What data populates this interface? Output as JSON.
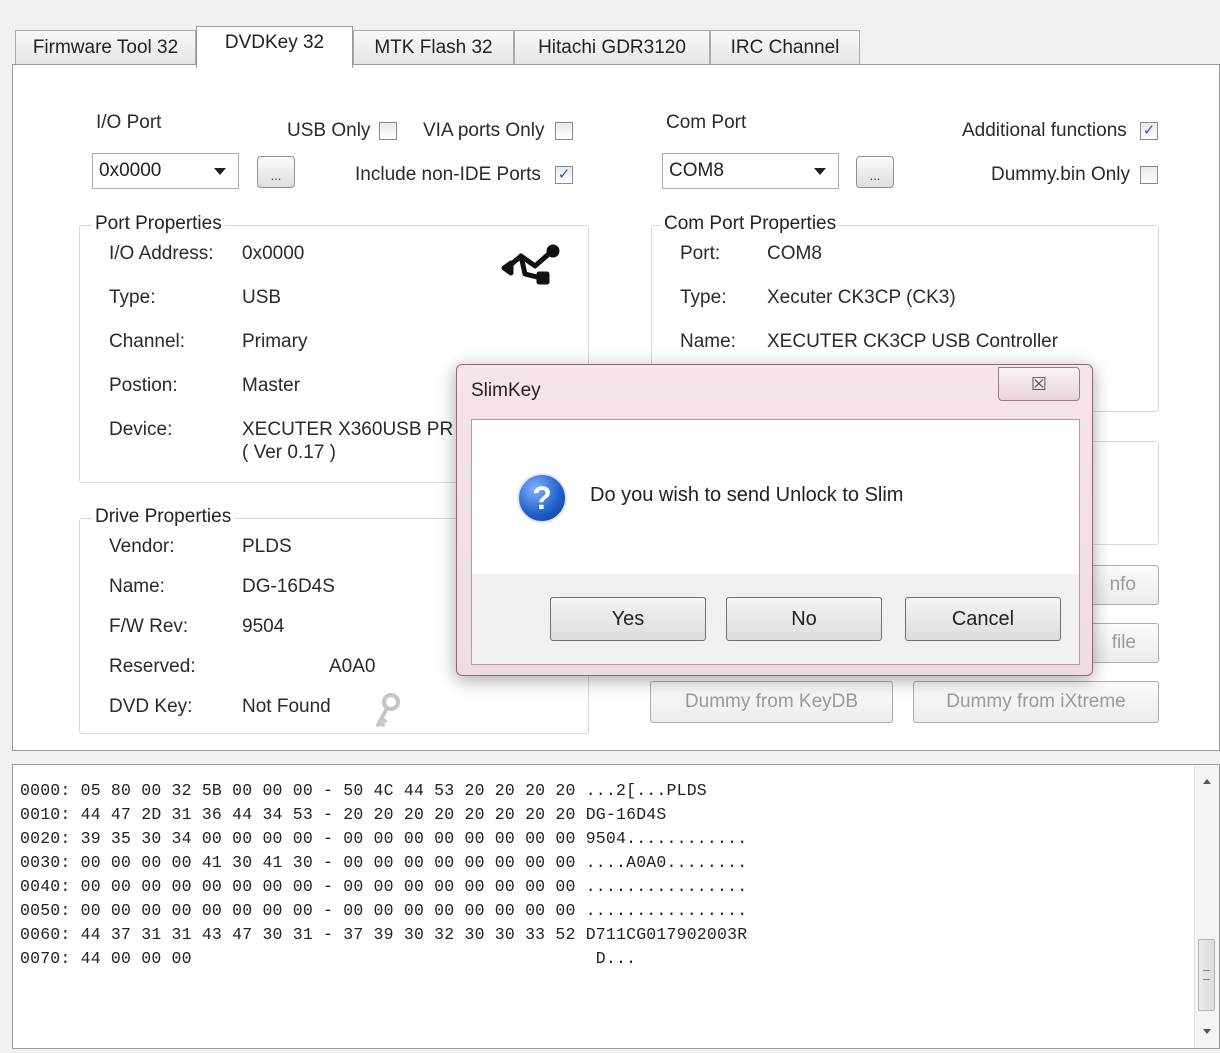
{
  "tabs": [
    {
      "label": "Firmware Tool 32"
    },
    {
      "label": "DVDKey 32"
    },
    {
      "label": "MTK Flash 32"
    },
    {
      "label": "Hitachi GDR3120"
    },
    {
      "label": "IRC Channel"
    }
  ],
  "io": {
    "port_label": "I/O Port",
    "port_value": "0x0000",
    "usb_only_label": "USB Only",
    "via_only_label": "VIA ports Only",
    "include_non_ide_label": "Include non-IDE Ports",
    "browse_label": "...",
    "usb_only_checked": false,
    "via_only_checked": false,
    "include_non_ide_checked": true
  },
  "com": {
    "port_label": "Com Port",
    "port_value": "COM8",
    "additional_label": "Additional functions",
    "dummy_bin_label": "Dummy.bin Only",
    "browse_label": "...",
    "additional_checked": true,
    "dummy_bin_checked": false
  },
  "port_props": {
    "title": "Port Properties",
    "rows": [
      {
        "label": "I/O Address:",
        "value": "0x0000"
      },
      {
        "label": "Type:",
        "value": "USB"
      },
      {
        "label": "Channel:",
        "value": "Primary"
      },
      {
        "label": "Postion:",
        "value": "Master"
      },
      {
        "label": "Device:",
        "value": "XECUTER X360USB PR",
        "extra": "( Ver 0.17 )"
      }
    ]
  },
  "com_props": {
    "title": "Com Port Properties",
    "rows": [
      {
        "label": "Port:",
        "value": "COM8"
      },
      {
        "label": "Type:",
        "value": "Xecuter CK3CP (CK3)"
      },
      {
        "label": "Name:",
        "value": "XECUTER CK3CP USB Controller"
      }
    ]
  },
  "drive_props": {
    "title": "Drive Properties",
    "rows": [
      {
        "label": "Vendor:",
        "value": "PLDS"
      },
      {
        "label": "Name:",
        "value": "DG-16D4S"
      },
      {
        "label": "F/W Rev:",
        "value": "9504"
      },
      {
        "label": "Reserved:",
        "value": "A0A0"
      },
      {
        "label": "DVD Key:",
        "value": "Not Found"
      }
    ]
  },
  "right_buttons": {
    "info_partial": "nfo",
    "file_partial": "file",
    "dummy_keydb": "Dummy from KeyDB",
    "dummy_ixtreme": "Dummy from iXtreme"
  },
  "hex_lines": [
    "0000: 05 80 00 32 5B 00 00 00 - 50 4C 44 53 20 20 20 20 ...2[...PLDS",
    "0010: 44 47 2D 31 36 44 34 53 - 20 20 20 20 20 20 20 20 DG-16D4S",
    "0020: 39 35 30 34 00 00 00 00 - 00 00 00 00 00 00 00 00 9504............",
    "0030: 00 00 00 00 41 30 41 30 - 00 00 00 00 00 00 00 00 ....A0A0........",
    "0040: 00 00 00 00 00 00 00 00 - 00 00 00 00 00 00 00 00 ................",
    "0050: 00 00 00 00 00 00 00 00 - 00 00 00 00 00 00 00 00 ................",
    "0060: 44 37 31 31 43 47 30 31 - 37 39 30 32 30 30 33 52 D711CG017902003R",
    "0070: 44 00 00 00                                        D..."
  ],
  "dialog": {
    "title": "SlimKey",
    "close": "☒",
    "message": "Do you wish to send Unlock to Slim",
    "yes": "Yes",
    "no": "No",
    "cancel": "Cancel",
    "icon": "question-icon"
  }
}
